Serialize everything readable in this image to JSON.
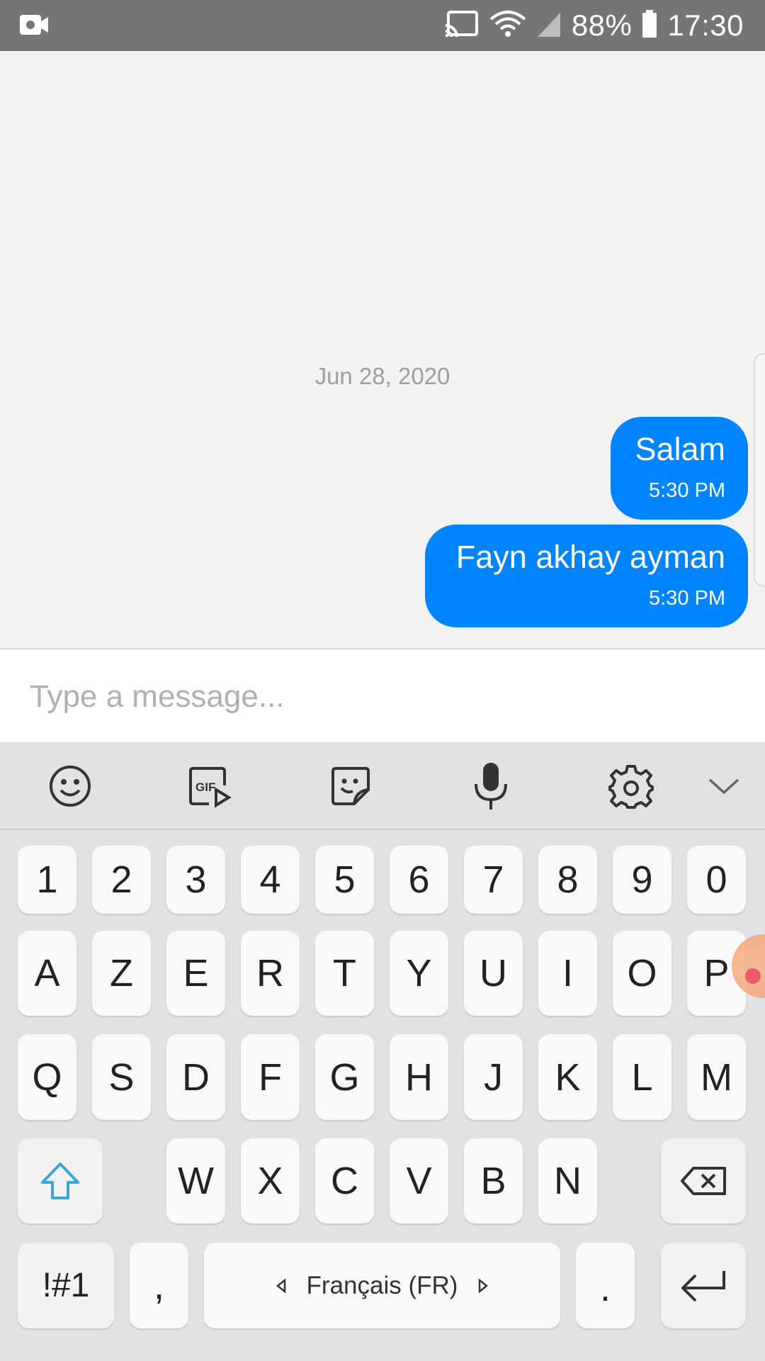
{
  "status_bar": {
    "battery": "88%",
    "time": "17:30"
  },
  "chat": {
    "date_separator": "Jun 28, 2020",
    "messages": [
      {
        "text": "Salam",
        "time": "5:30 PM"
      },
      {
        "text": "Fayn akhay ayman",
        "time": "5:30 PM"
      }
    ]
  },
  "composer": {
    "placeholder": "Type a message..."
  },
  "keyboard": {
    "toolbar": [
      "emoji-icon",
      "gif-icon",
      "sticker-icon",
      "microphone-icon",
      "settings-icon",
      "collapse-icon"
    ],
    "number_row": [
      "1",
      "2",
      "3",
      "4",
      "5",
      "6",
      "7",
      "8",
      "9",
      "0"
    ],
    "row1": [
      "A",
      "Z",
      "E",
      "R",
      "T",
      "Y",
      "U",
      "I",
      "O",
      "P"
    ],
    "row2": [
      "Q",
      "S",
      "D",
      "F",
      "G",
      "H",
      "J",
      "K",
      "L",
      "M"
    ],
    "row3": [
      "W",
      "X",
      "C",
      "V",
      "B",
      "N"
    ],
    "symbols_label": "!#1",
    "comma": ",",
    "space_label": "Français (FR)",
    "period": "."
  },
  "colors": {
    "bubble": "#0084ff",
    "status_bar": "#757575",
    "keyboard_bg": "#e1e2e4",
    "shift_accent": "#3aa6d8"
  }
}
